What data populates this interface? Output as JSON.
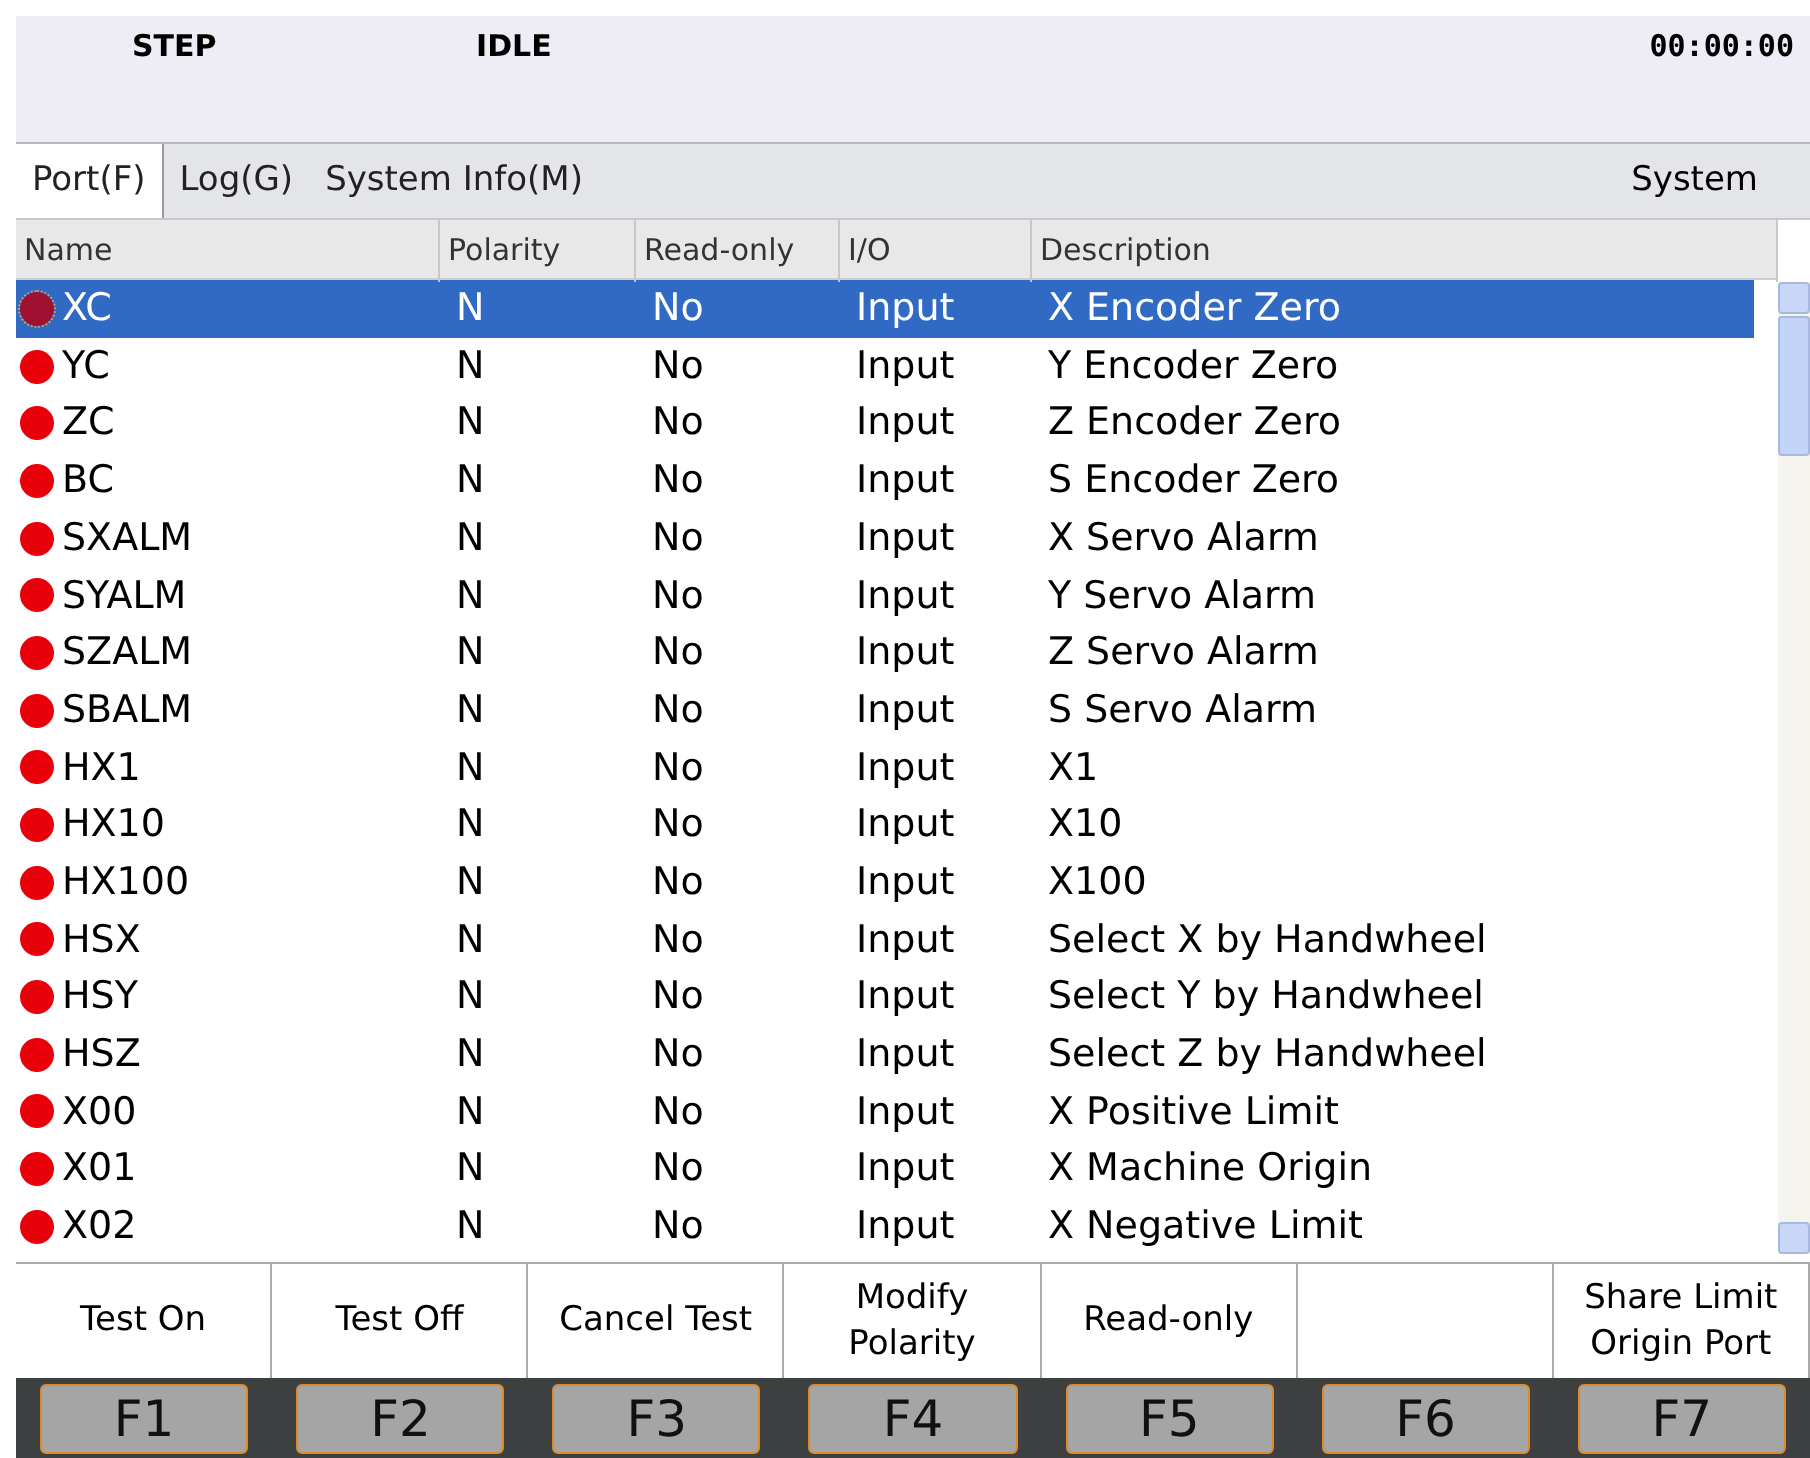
{
  "status_bar": {
    "mode": "STEP",
    "state": "IDLE",
    "time": "00:00:00"
  },
  "tabs": [
    {
      "label": "Port(F)",
      "selected": true
    },
    {
      "label": "Log(G)",
      "selected": false
    },
    {
      "label": "System Info(M)",
      "selected": false
    }
  ],
  "tab_bar_label": "System",
  "table": {
    "columns": [
      "Name",
      "Polarity",
      "Read-only",
      "I/O",
      "Description"
    ],
    "rows": [
      {
        "cells": [
          "XC",
          "N",
          "No",
          "Input",
          "X Encoder Zero"
        ],
        "selected": true
      },
      {
        "cells": [
          "YC",
          "N",
          "No",
          "Input",
          "Y Encoder Zero"
        ],
        "selected": false
      },
      {
        "cells": [
          "ZC",
          "N",
          "No",
          "Input",
          "Z Encoder Zero"
        ],
        "selected": false
      },
      {
        "cells": [
          "BC",
          "N",
          "No",
          "Input",
          "S Encoder Zero"
        ],
        "selected": false
      },
      {
        "cells": [
          "SXALM",
          "N",
          "No",
          "Input",
          "X Servo Alarm"
        ],
        "selected": false
      },
      {
        "cells": [
          "SYALM",
          "N",
          "No",
          "Input",
          "Y Servo Alarm"
        ],
        "selected": false
      },
      {
        "cells": [
          "SZALM",
          "N",
          "No",
          "Input",
          "Z Servo Alarm"
        ],
        "selected": false
      },
      {
        "cells": [
          "SBALM",
          "N",
          "No",
          "Input",
          "S Servo Alarm"
        ],
        "selected": false
      },
      {
        "cells": [
          "HX1",
          "N",
          "No",
          "Input",
          "X1"
        ],
        "selected": false
      },
      {
        "cells": [
          "HX10",
          "N",
          "No",
          "Input",
          "X10"
        ],
        "selected": false
      },
      {
        "cells": [
          "HX100",
          "N",
          "No",
          "Input",
          "X100"
        ],
        "selected": false
      },
      {
        "cells": [
          "HSX",
          "N",
          "No",
          "Input",
          "Select X by Handwheel"
        ],
        "selected": false
      },
      {
        "cells": [
          "HSY",
          "N",
          "No",
          "Input",
          "Select Y by Handwheel"
        ],
        "selected": false
      },
      {
        "cells": [
          "HSZ",
          "N",
          "No",
          "Input",
          "Select Z by Handwheel"
        ],
        "selected": false
      },
      {
        "cells": [
          "X00",
          "N",
          "No",
          "Input",
          "X Positive Limit"
        ],
        "selected": false
      },
      {
        "cells": [
          "X01",
          "N",
          "No",
          "Input",
          "X Machine Origin"
        ],
        "selected": false
      },
      {
        "cells": [
          "X02",
          "N",
          "No",
          "Input",
          "X Negative Limit"
        ],
        "selected": false
      }
    ]
  },
  "softkeys": [
    {
      "label": "Test On",
      "key": "F1"
    },
    {
      "label": "Test Off",
      "key": "F2"
    },
    {
      "label": "Cancel Test",
      "key": "F3"
    },
    {
      "label": "Modify\nPolarity",
      "key": "F4"
    },
    {
      "label": "Read-only",
      "key": "F5"
    },
    {
      "key": "F6"
    },
    {
      "label": "Share Limit\nOrigin Port",
      "key": "F7"
    }
  ]
}
